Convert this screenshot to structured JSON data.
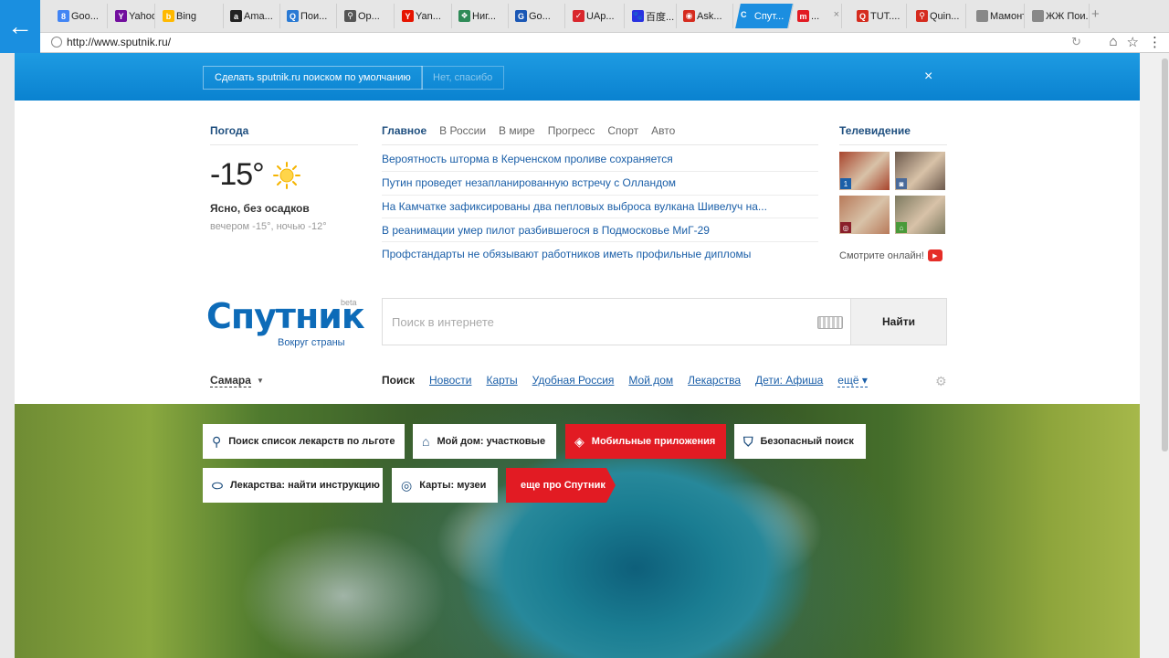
{
  "browser": {
    "tabs": [
      {
        "label": "Goo...",
        "icon": "google-icon",
        "icon_color": "#4285f4",
        "glyph": "8"
      },
      {
        "label": "Yahoo",
        "icon": "yahoo-icon",
        "icon_color": "#720e9e",
        "glyph": "Y"
      },
      {
        "label": "Bing",
        "icon": "bing-icon",
        "icon_color": "#ffb900",
        "glyph": "b"
      },
      {
        "label": "Ama...",
        "icon": "amazon-icon",
        "icon_color": "#222222",
        "glyph": "a"
      },
      {
        "label": "Пои...",
        "icon": "search-icon",
        "icon_color": "#2a7ad4",
        "glyph": "Q"
      },
      {
        "label": "Op...",
        "icon": "search-icon",
        "icon_color": "#555555",
        "glyph": "⚲"
      },
      {
        "label": "Yan...",
        "icon": "yandex-icon",
        "icon_color": "#e61400",
        "glyph": "Y"
      },
      {
        "label": "Ниг...",
        "icon": "nigma-icon",
        "icon_color": "#2e8b57",
        "glyph": "❖"
      },
      {
        "label": "Go...",
        "icon": "go-icon",
        "icon_color": "#1a57b5",
        "glyph": "G"
      },
      {
        "label": "UAp...",
        "icon": "uaport-icon",
        "icon_color": "#d9262c",
        "glyph": "✓"
      },
      {
        "label": "百度...",
        "icon": "baidu-icon",
        "icon_color": "#2932e1",
        "glyph": "🐾"
      },
      {
        "label": "Ask...",
        "icon": "ask-icon",
        "icon_color": "#d52b1e",
        "glyph": "◉"
      },
      {
        "label": "Спут...",
        "icon": "sputnik-icon",
        "icon_color": "#ffffff",
        "glyph": "C"
      },
      {
        "label": "...",
        "icon": "mailru-icon",
        "icon_color": "#e21b23",
        "glyph": "m"
      },
      {
        "label": "TUT....",
        "icon": "tut-icon",
        "icon_color": "#d52b1e",
        "glyph": "Q"
      },
      {
        "label": "Quin...",
        "icon": "search-icon",
        "icon_color": "#d52b1e",
        "glyph": "⚲"
      },
      {
        "label": "Мамонт...",
        "icon": "mamont-icon",
        "icon_color": "#888888",
        "glyph": ""
      },
      {
        "label": "ЖЖ Пои...",
        "icon": "lj-icon",
        "icon_color": "#888888",
        "glyph": ""
      }
    ],
    "new_tab": "+",
    "url": "http://www.sputnik.ru/"
  },
  "banner": {
    "default_label": "Сделать sputnik.ru поиском по умолчанию",
    "decline_label": "Нет, спасибо",
    "close": "×"
  },
  "weather": {
    "title": "Погода",
    "temp": "-15°",
    "desc": "Ясно, без осадков",
    "sub": "вечером -15°, ночью -12°"
  },
  "news": {
    "tabs": [
      "Главное",
      "В России",
      "В мире",
      "Прогресс",
      "Спорт",
      "Авто"
    ],
    "items": [
      "Вероятность шторма в Керченском проливе сохраняется",
      "Путин проведет незапланированную встречу с Олландом",
      "На Камчатке зафиксированы два пепловых выброса вулкана Шивелуч на...",
      "В реанимации умер пилот разбившегося в Подмосковье МиГ-29",
      "Профстандарты не обязывают работников иметь профильные дипломы"
    ]
  },
  "tv": {
    "title": "Телевидение",
    "watch": "Смотрите онлайн!",
    "channels": [
      "1",
      "◙",
      "◎",
      "⌂"
    ],
    "thumb_colors": [
      "#a8442c",
      "#6d5a4d",
      "#b87a5a",
      "#7d7a60"
    ]
  },
  "logo": {
    "name": "Спутник",
    "beta": "beta",
    "tagline": "Вокруг страны"
  },
  "search": {
    "placeholder": "Поиск в интернете",
    "button": "Найти"
  },
  "city": "Самара",
  "services": {
    "items": [
      "Поиск",
      "Новости",
      "Карты",
      "Удобная Россия",
      "Мой дом",
      "Лекарства",
      "Дети: Афиша"
    ],
    "more": "ещё"
  },
  "promo": [
    {
      "label": "Поиск список лекарств по льготе",
      "icon": "search-icon",
      "red": false
    },
    {
      "label": "Мой дом: участковые",
      "icon": "home-icon",
      "red": false
    },
    {
      "label": "Мобильные приложения",
      "icon": "mobile-apps-icon",
      "red": true
    },
    {
      "label": "Безопасный поиск",
      "icon": "shield-icon",
      "red": false
    },
    {
      "label": "Лекарства: найти инструкцию",
      "icon": "pill-icon",
      "red": false
    },
    {
      "label": "Карты: музеи",
      "icon": "map-pin-icon",
      "red": false
    },
    {
      "label": "еще про Спутник",
      "icon": "",
      "red": true
    }
  ],
  "colors": {
    "accent": "#1b8ee0",
    "link": "#1b5fa8",
    "brand_red": "#e21b23",
    "heading": "#1f4f7f"
  }
}
